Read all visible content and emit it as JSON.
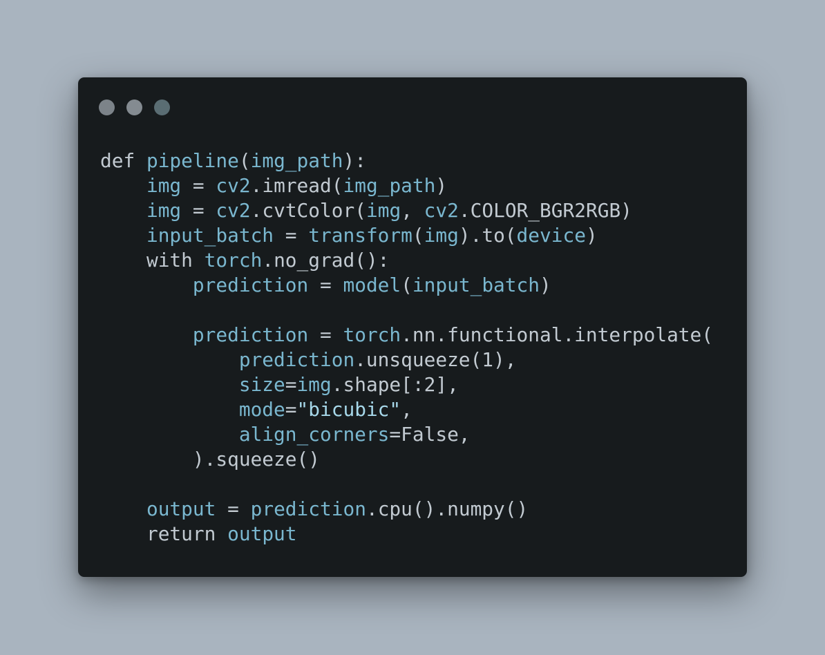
{
  "window": {
    "dots": [
      {
        "name": "close-dot",
        "color": "#7c8389"
      },
      {
        "name": "minimize-dot",
        "color": "#848b91"
      },
      {
        "name": "maximize-dot",
        "color": "#5a6d73"
      }
    ]
  },
  "colors": {
    "background": "#a9b4bf",
    "editor": "#171b1d",
    "keyword": "#c2cad1",
    "identifier": "#7ab7cf",
    "punctuation": "#c2cad1",
    "string": "#a7d8ea"
  },
  "code": {
    "lines": [
      [
        [
          "kw",
          "def "
        ],
        [
          "id",
          "pipeline"
        ],
        [
          "p",
          "("
        ],
        [
          "id",
          "img_path"
        ],
        [
          "p",
          "):"
        ]
      ],
      [
        [
          "p",
          "    "
        ],
        [
          "id",
          "img"
        ],
        [
          "p",
          " = "
        ],
        [
          "id",
          "cv2"
        ],
        [
          "p",
          ".imread("
        ],
        [
          "id",
          "img_path"
        ],
        [
          "p",
          ")"
        ]
      ],
      [
        [
          "p",
          "    "
        ],
        [
          "id",
          "img"
        ],
        [
          "p",
          " = "
        ],
        [
          "id",
          "cv2"
        ],
        [
          "p",
          ".cvtColor("
        ],
        [
          "id",
          "img"
        ],
        [
          "p",
          ", "
        ],
        [
          "id",
          "cv2"
        ],
        [
          "p",
          ".COLOR_BGR2RGB)"
        ]
      ],
      [
        [
          "p",
          "    "
        ],
        [
          "id",
          "input_batch"
        ],
        [
          "p",
          " = "
        ],
        [
          "id",
          "transform"
        ],
        [
          "p",
          "("
        ],
        [
          "id",
          "img"
        ],
        [
          "p",
          ").to("
        ],
        [
          "id",
          "device"
        ],
        [
          "p",
          ")"
        ]
      ],
      [
        [
          "p",
          "    "
        ],
        [
          "kw",
          "with "
        ],
        [
          "id",
          "torch"
        ],
        [
          "p",
          ".no_grad():"
        ]
      ],
      [
        [
          "p",
          "        "
        ],
        [
          "id",
          "prediction"
        ],
        [
          "p",
          " = "
        ],
        [
          "id",
          "model"
        ],
        [
          "p",
          "("
        ],
        [
          "id",
          "input_batch"
        ],
        [
          "p",
          ")"
        ]
      ],
      [],
      [
        [
          "p",
          "        "
        ],
        [
          "id",
          "prediction"
        ],
        [
          "p",
          " = "
        ],
        [
          "id",
          "torch"
        ],
        [
          "p",
          ".nn.functional.interpolate("
        ]
      ],
      [
        [
          "p",
          "            "
        ],
        [
          "id",
          "prediction"
        ],
        [
          "p",
          ".unsqueeze(1),"
        ]
      ],
      [
        [
          "p",
          "            "
        ],
        [
          "id",
          "size"
        ],
        [
          "p",
          "="
        ],
        [
          "id",
          "img"
        ],
        [
          "p",
          ".shape[:2],"
        ]
      ],
      [
        [
          "p",
          "            "
        ],
        [
          "id",
          "mode"
        ],
        [
          "p",
          "="
        ],
        [
          "str",
          "\"bicubic\""
        ],
        [
          "p",
          ","
        ]
      ],
      [
        [
          "p",
          "            "
        ],
        [
          "id",
          "align_corners"
        ],
        [
          "p",
          "=False,"
        ]
      ],
      [
        [
          "p",
          "        ).squeeze()"
        ]
      ],
      [],
      [
        [
          "p",
          "    "
        ],
        [
          "id",
          "output"
        ],
        [
          "p",
          " = "
        ],
        [
          "id",
          "prediction"
        ],
        [
          "p",
          ".cpu().numpy()"
        ]
      ],
      [
        [
          "p",
          "    "
        ],
        [
          "kw",
          "return "
        ],
        [
          "id",
          "output"
        ]
      ]
    ]
  }
}
